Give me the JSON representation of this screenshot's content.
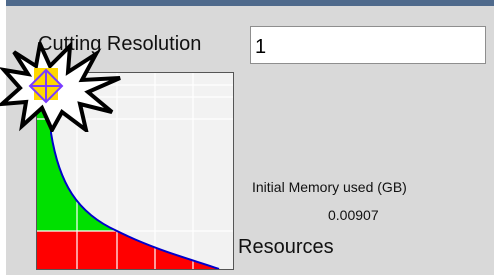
{
  "cutting_resolution": {
    "label": "Cutting Resolution",
    "value": "1"
  },
  "memory": {
    "label": "Initial Memory used (GB)",
    "value": "0.00907"
  },
  "graph": {
    "axis_label": "Resources",
    "colors": {
      "top": "#ffd700",
      "middle": "#00e000",
      "bottom": "#ff0000",
      "curve": "#0000cc",
      "grid": "#ffffff",
      "background": "#f2f2f2"
    }
  },
  "icons": {
    "alert": "starburst-alert-icon"
  }
}
